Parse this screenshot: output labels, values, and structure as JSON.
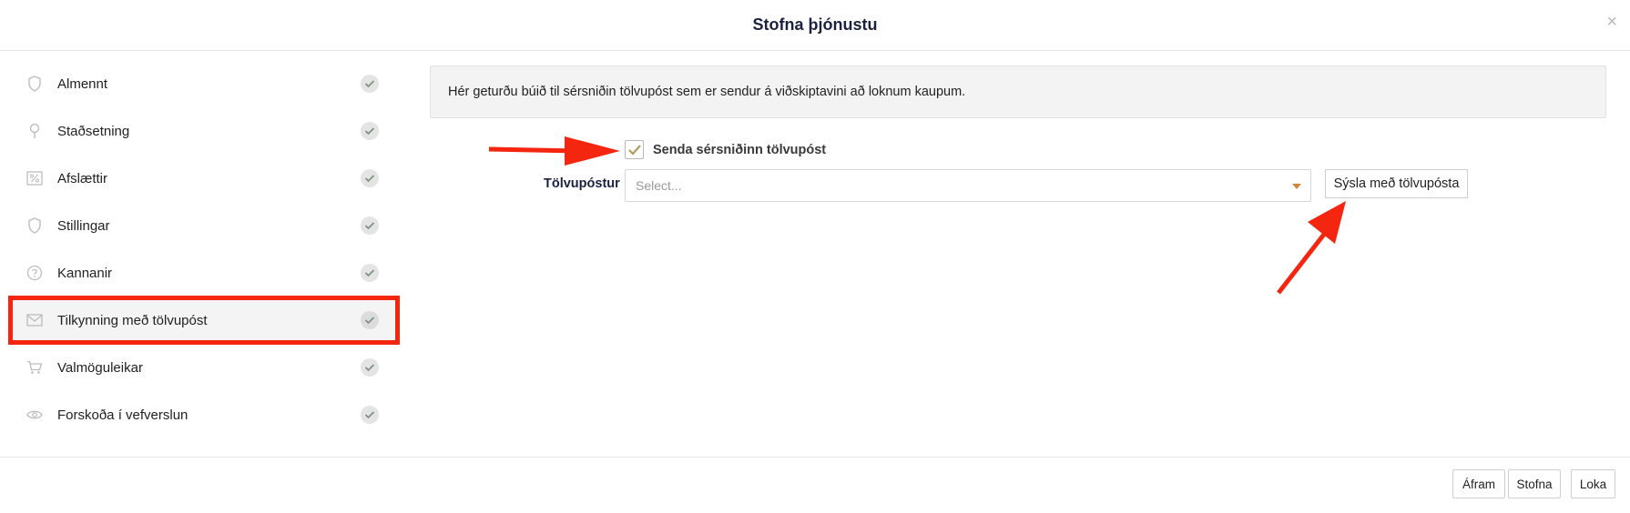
{
  "modal": {
    "title": "Stofna þjónustu",
    "close_glyph": "×"
  },
  "sidebar": {
    "items": [
      {
        "label": "Almennt",
        "icon": "shield-icon"
      },
      {
        "label": "Staðsetning",
        "icon": "location-pin-icon"
      },
      {
        "label": "Afslættir",
        "icon": "percent-icon"
      },
      {
        "label": "Stillingar",
        "icon": "shield-icon"
      },
      {
        "label": "Kannanir",
        "icon": "question-icon"
      },
      {
        "label": "Tilkynning með tölvupóst",
        "icon": "envelope-icon",
        "active": true
      },
      {
        "label": "Valmöguleikar",
        "icon": "cart-icon"
      },
      {
        "label": "Forskoða í vefverslun",
        "icon": "eye-icon"
      }
    ]
  },
  "main": {
    "info_text": "Hér geturðu búið til sérsniðin tölvupóst sem er sendur á viðskiptavini að loknum kaupum.",
    "checkbox_label": "Senda sérsniðinn tölvupóst",
    "checkbox_checked": true,
    "email_label": "Tölvupóstur",
    "email_placeholder": "Select...",
    "manage_button": "Sýsla með tölvupósta"
  },
  "footer": {
    "next_button": "Áfram",
    "create_button": "Stofna",
    "close_button": "Loka"
  },
  "colors": {
    "annotation_red": "#f4260f",
    "check_gold": "#b39a64",
    "caret_orange": "#d2873c",
    "title_navy": "#1b2140"
  }
}
